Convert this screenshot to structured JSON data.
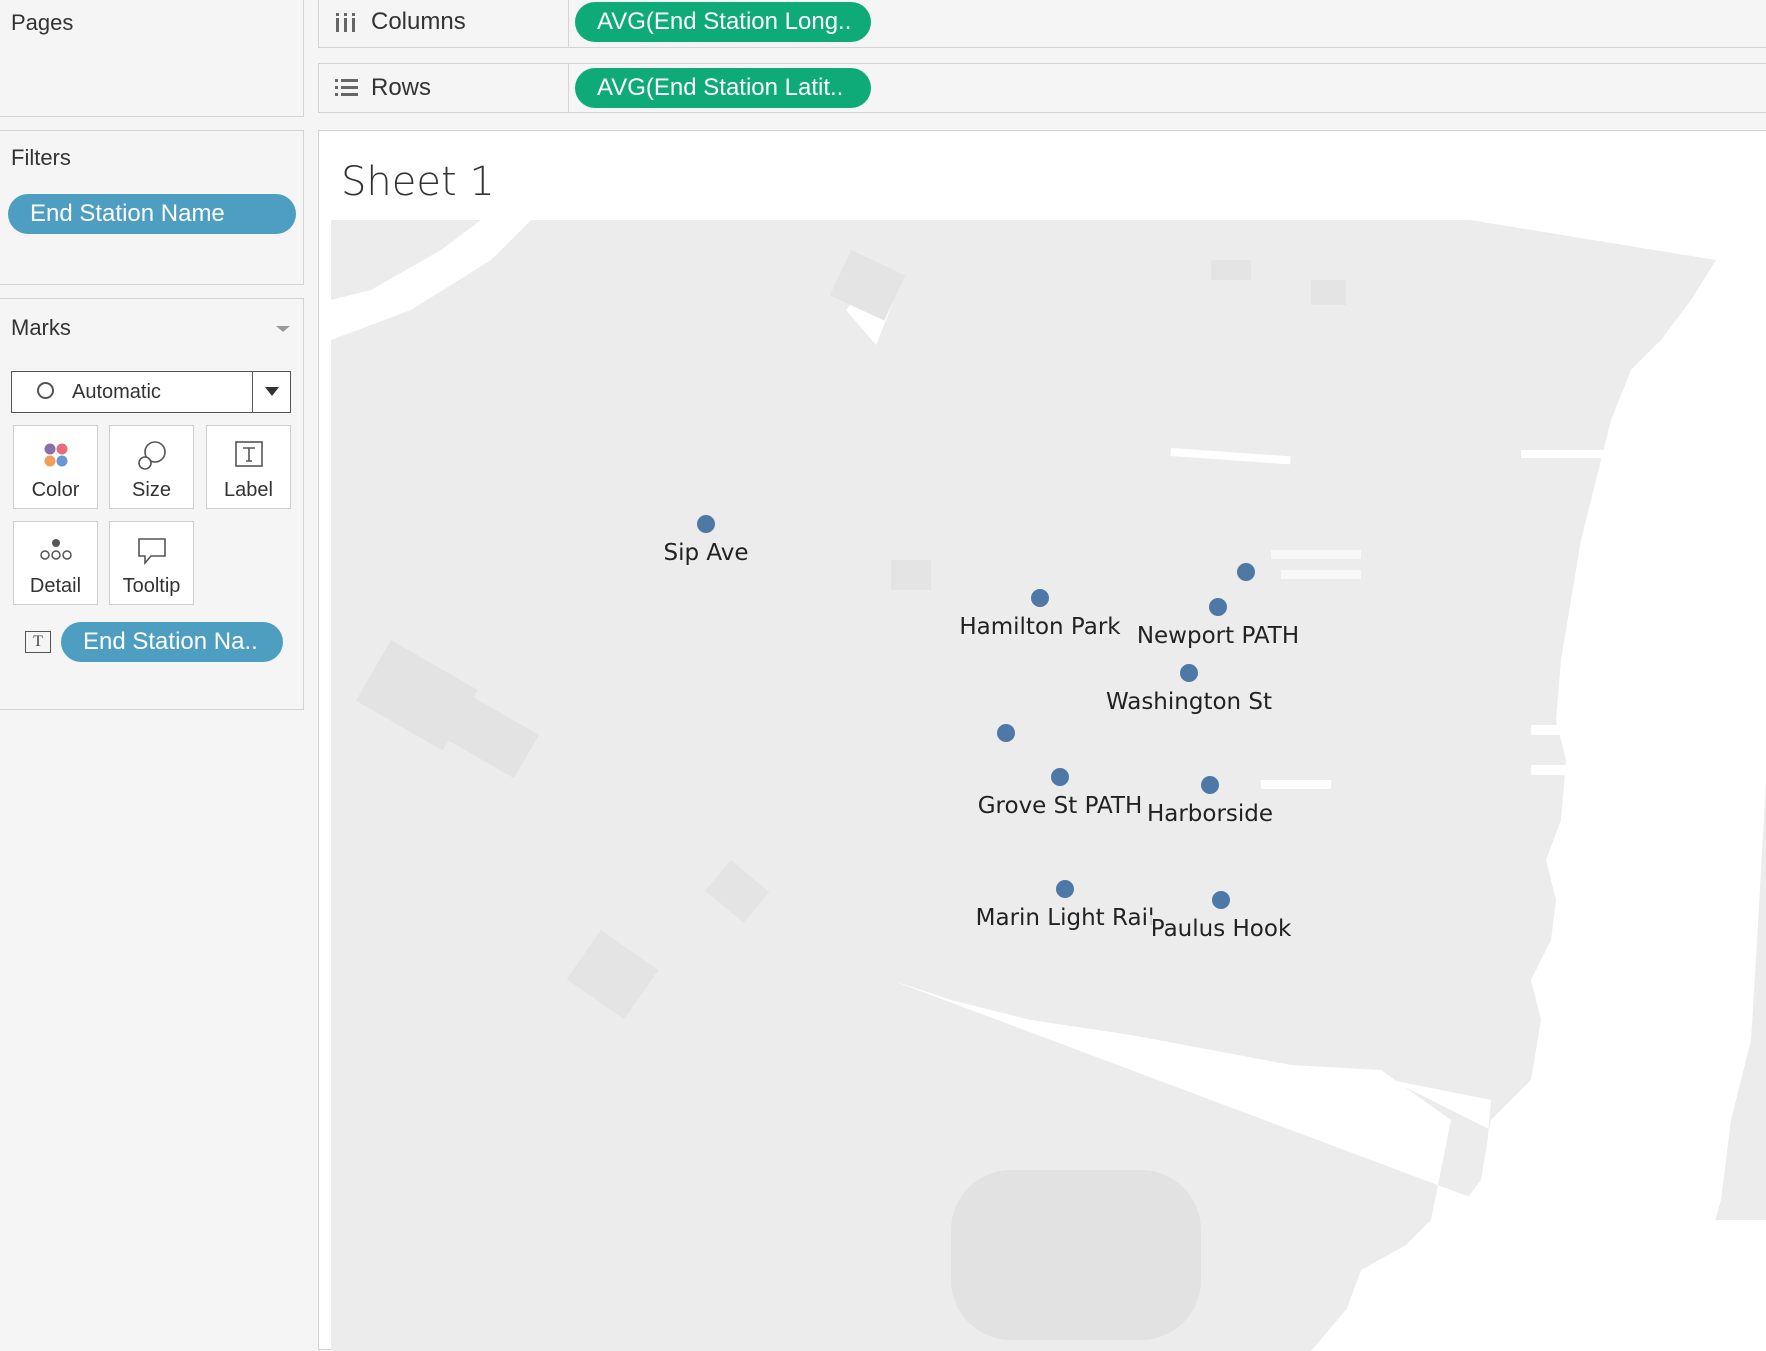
{
  "pages": {
    "title": "Pages"
  },
  "filters": {
    "title": "Filters",
    "pill": "End Station Name"
  },
  "marks": {
    "title": "Marks",
    "mark_type": "Automatic",
    "buttons": {
      "color": "Color",
      "size": "Size",
      "label": "Label",
      "detail": "Detail",
      "tooltip": "Tooltip"
    },
    "label_field_pill": "End Station Na..",
    "label_icon_text": "T"
  },
  "columns_shelf": {
    "label": "Columns",
    "pill": "AVG(End Station Long.."
  },
  "rows_shelf": {
    "label": "Rows",
    "pill": "AVG(End Station Latit.."
  },
  "sheet": {
    "title": "Sheet 1"
  },
  "map_marks": [
    {
      "name": "Sip Ave"
    },
    {
      "name": "Hamilton Park"
    },
    {
      "name": ""
    },
    {
      "name": "Newport PATH"
    },
    {
      "name": "Washington St"
    },
    {
      "name": ""
    },
    {
      "name": "Grove St PATH"
    },
    {
      "name": "Harborside"
    },
    {
      "name": "Marin Light Rail"
    },
    {
      "name": "Paulus Hook"
    }
  ],
  "colors": {
    "mark": "#4e79a7",
    "pill_blue": "#4d9ec1",
    "pill_green": "#0eab78",
    "water": "#ffffff",
    "land": "#ececec"
  }
}
